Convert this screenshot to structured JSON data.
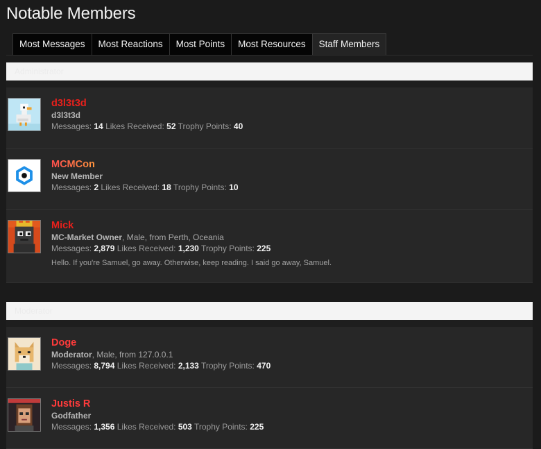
{
  "page": {
    "title": "Notable Members"
  },
  "tabs": [
    "Most Messages",
    "Most Reactions",
    "Most Points",
    "Most Resources",
    "Staff Members"
  ],
  "active_tab": 4,
  "stat_labels": {
    "messages": "Messages:",
    "likes": "Likes Received:",
    "points": "Trophy Points:"
  },
  "sections": [
    {
      "heading": "Administrator",
      "members": [
        {
          "name": "d3l3t3d",
          "title": "d3l3t3d",
          "details": "",
          "messages": "14",
          "likes": "52",
          "points": "40",
          "bio": ""
        },
        {
          "name": "MCMCon",
          "title": "New Member",
          "details": "",
          "messages": "2",
          "likes": "18",
          "points": "10",
          "bio": ""
        },
        {
          "name": "Mick",
          "title": "MC-Market Owner",
          "details": ", Male, from Perth, Oceania",
          "messages": "2,879",
          "likes": "1,230",
          "points": "225",
          "bio": "Hello. If you're Samuel, go away. Otherwise, keep reading. I said go away, Samuel."
        }
      ]
    },
    {
      "heading": "Moderator",
      "members": [
        {
          "name": "Doge",
          "title": "Moderator",
          "details": ", Male, from 127.0.0.1",
          "messages": "8,794",
          "likes": "2,133",
          "points": "470",
          "bio": ""
        },
        {
          "name": "Justis R",
          "title": "Godfather",
          "details": "",
          "messages": "1,356",
          "likes": "503",
          "points": "225",
          "bio": ""
        }
      ]
    }
  ]
}
